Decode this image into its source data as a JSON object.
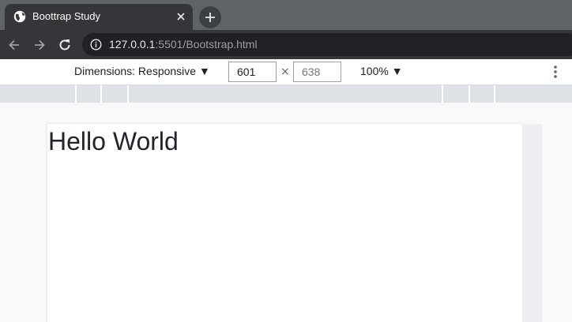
{
  "browser": {
    "tab": {
      "title": "Boottrap Study",
      "favicon": "globe-icon"
    },
    "new_tab": "plus-icon",
    "url": {
      "host": "127.0.0.1",
      "path": ":5501/Bootstrap.html"
    }
  },
  "device_toolbar": {
    "dimensions_label": "Dimensions: Responsive ▼",
    "width": "601",
    "height_placeholder": "638",
    "times": "×",
    "zoom_label": "100% ▼"
  },
  "page": {
    "heading": "Hello World"
  },
  "colors": {
    "tabstrip": "#5f6368",
    "active_tab": "#35363a",
    "omnibox": "#202124",
    "mq_bar": "#dee1e6"
  }
}
